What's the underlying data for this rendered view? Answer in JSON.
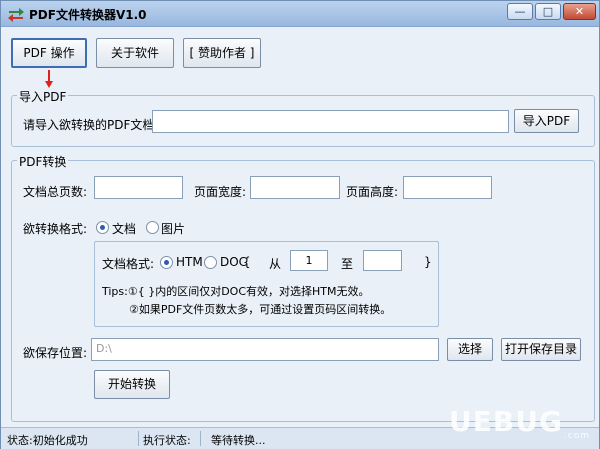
{
  "window": {
    "title": "PDF文件转换器V1.0",
    "min_symbol": "—",
    "max_symbol": "□",
    "close_symbol": "✕"
  },
  "toolbar": {
    "pdf_ops_label": "PDF 操作",
    "about_label": "关于软件",
    "sponsor_label": "[ 赞助作者 ]"
  },
  "import_group": {
    "title": "导入PDF",
    "prompt_label": "请导入欲转换的PDF文档:",
    "file_value": "",
    "import_button": "导入PDF"
  },
  "convert_group": {
    "title": "PDF转换",
    "total_pages_label": "文档总页数:",
    "total_pages_value": "",
    "page_width_label": "页面宽度:",
    "page_width_value": "",
    "page_height_label": "页面高度:",
    "page_height_value": "",
    "format_label": "欲转换格式:",
    "format_options": [
      "文档",
      "图片"
    ],
    "format_selected": "文档",
    "doc_format_label": "文档格式:",
    "doc_format_options": [
      "HTM",
      "DOC"
    ],
    "doc_format_selected": "HTM",
    "brace_open": "{",
    "range_from_label": "从",
    "range_from_value": "1",
    "range_to_label": "至",
    "range_to_value": "",
    "brace_close": "}",
    "tip_line1": "Tips:①{ }内的区间仅对DOC有效，对选择HTM无效。",
    "tip_line2": "②如果PDF文件页数太多，可通过设置页码区间转换。",
    "save_label": "欲保存位置:",
    "save_path": "D:\\",
    "choose_button": "选择",
    "open_dir_button": "打开保存目录",
    "start_button": "开始转换"
  },
  "status": {
    "state_text": "状态:初始化成功",
    "exec_label": "执行状态:",
    "exec_value": "等待转换..."
  },
  "watermark": {
    "text": "UEBUG",
    "small": ".com"
  }
}
